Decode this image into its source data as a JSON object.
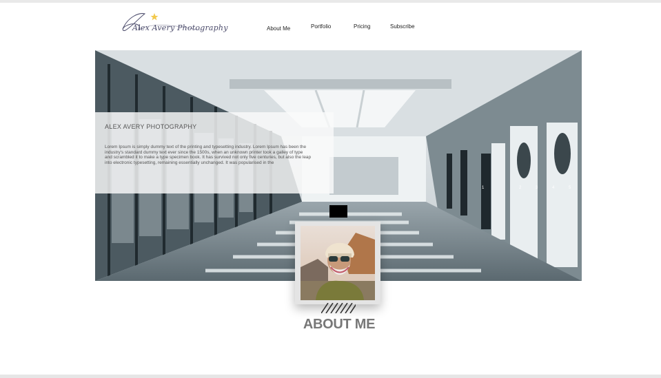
{
  "header": {
    "logo_text": "Alex Avery Photography",
    "nav": [
      "About Me",
      "Portfolio",
      "Pricing",
      "Subscribe"
    ]
  },
  "hero": {
    "title": "ALEX AVERY PHOTOGRAPHY",
    "body": "Lorem Ipsum is simply dummy text of the printing and typesetting industry. Lorem Ipsum has been the industry's standard dummy text ever since the 1500s, when an unknown printer took a galley of type and scrambled it to make a type specimen book. It has survived not only five centuries, but also the leap into electronic typesetting, remaining essentially unchanged. It was popularised in the",
    "pager": [
      "1",
      "2",
      "3",
      "4",
      "5"
    ]
  },
  "about": {
    "title": "ABOUT ME"
  },
  "colors": {
    "accent": "#777777",
    "logo_star": "#f2c94c"
  }
}
